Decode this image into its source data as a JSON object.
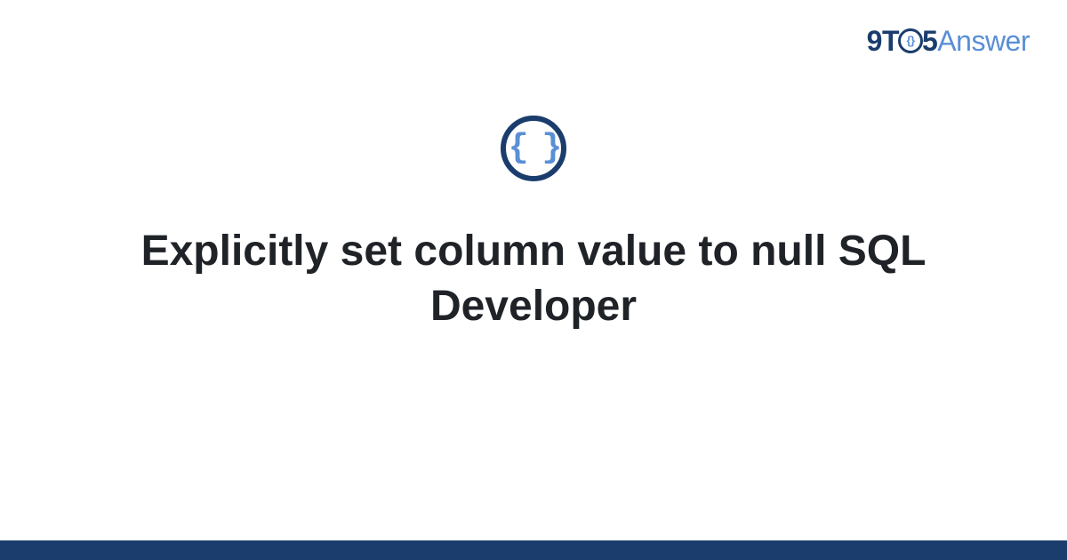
{
  "logo": {
    "part1": "9T",
    "circle_inner": "{}",
    "part2": "5",
    "part3": "Answer"
  },
  "icon": {
    "symbol": "{ }"
  },
  "title": "Explicitly set column value to null SQL Developer"
}
